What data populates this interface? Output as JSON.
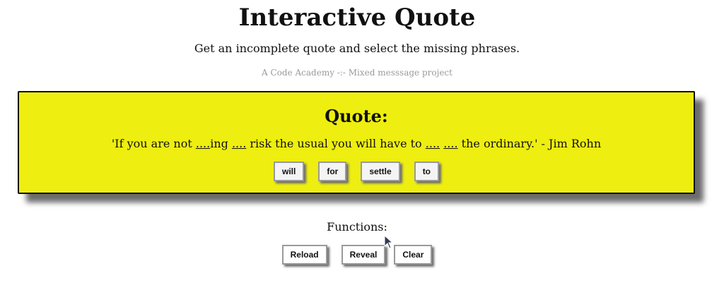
{
  "header": {
    "title": "Interactive Quote",
    "subtitle": "Get an incomplete quote and select the missing phrases.",
    "credit": "A Code Academy -:- Mixed messsage project"
  },
  "quote": {
    "heading": "Quote:",
    "part1": "'If you are not ",
    "blank1": "....",
    "part2": "ing ",
    "blank2": "....",
    "part3": " risk the usual you will have to ",
    "blank3": "....",
    "part4": " ",
    "blank4": "....",
    "part5": " the ordinary.' - Jim Rohn",
    "words": [
      "will",
      "for",
      "settle",
      "to"
    ]
  },
  "functions": {
    "label": "Functions:",
    "reload": "Reload",
    "reveal": "Reveal",
    "clear": "Clear"
  },
  "colors": {
    "quote_background": "#eeee10",
    "credit_text": "#9a9a9a"
  },
  "icons": {
    "cursor": "mouse-pointer-icon"
  }
}
